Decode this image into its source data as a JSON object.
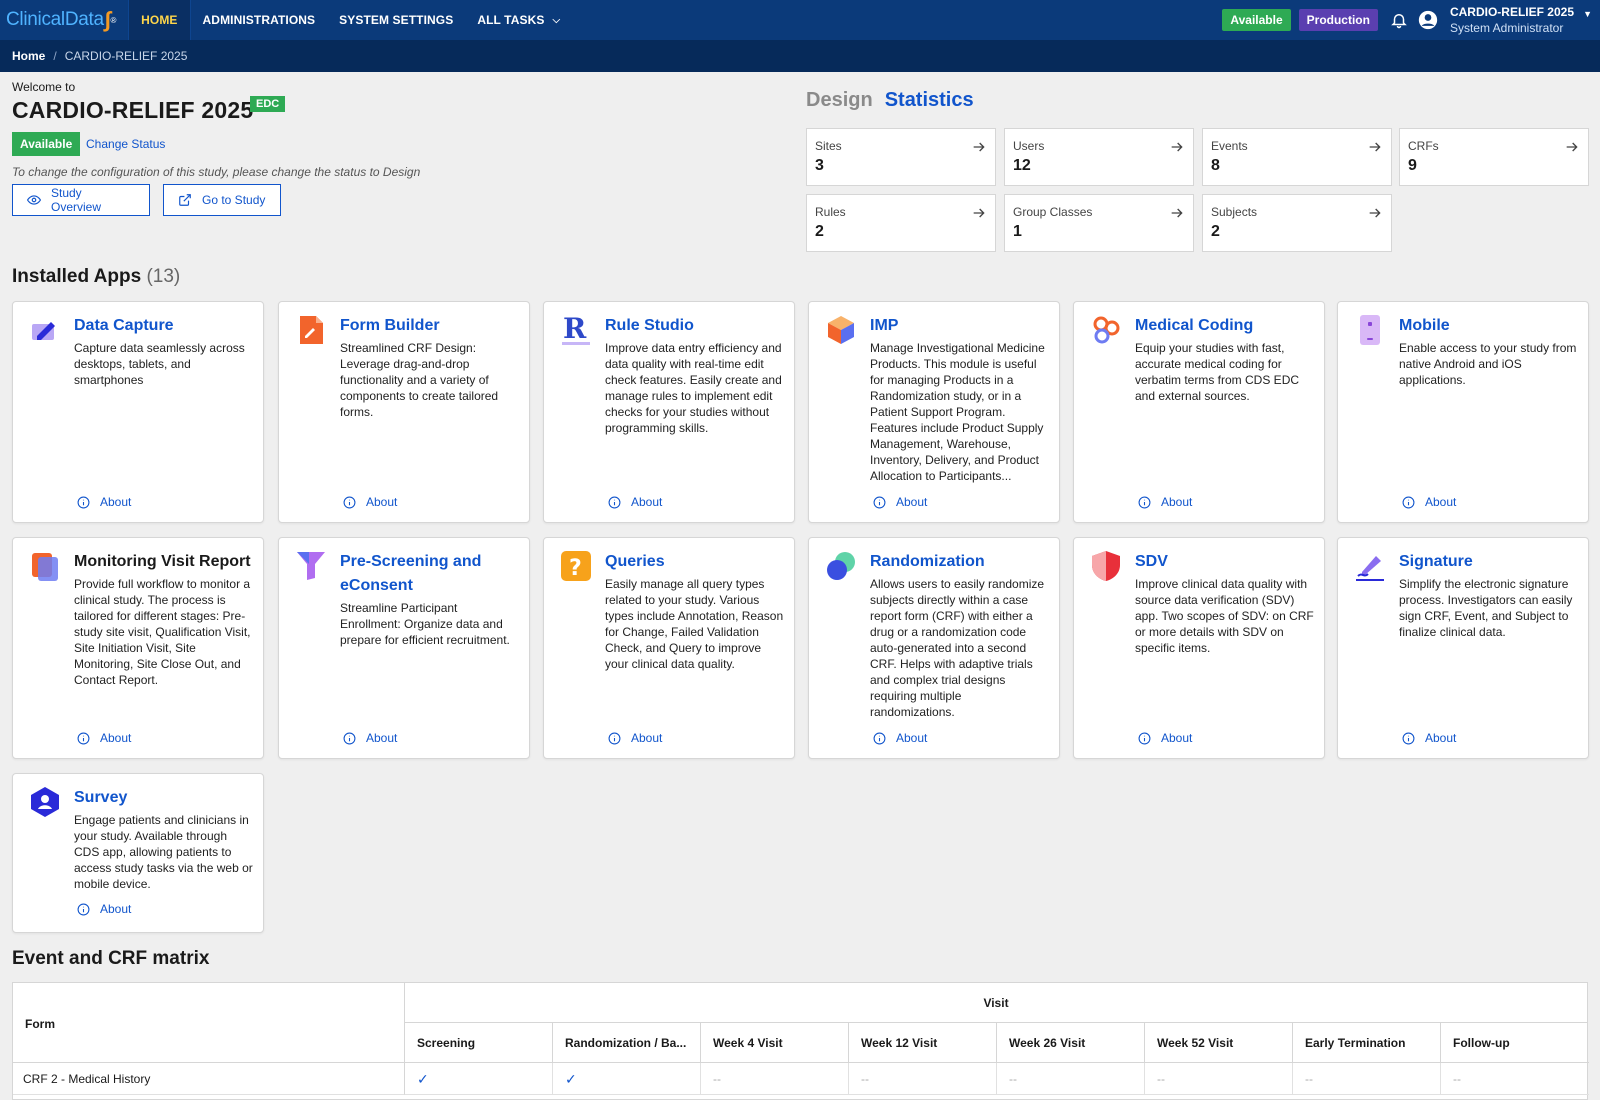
{
  "header": {
    "logo_text": "ClinicalData",
    "nav": [
      {
        "label": "HOME"
      },
      {
        "label": "ADMINISTRATIONS"
      },
      {
        "label": "SYSTEM SETTINGS"
      },
      {
        "label": "ALL TASKS"
      }
    ],
    "status_available": "Available",
    "env_label": "Production",
    "user_study": "CARDIO-RELIEF 2025",
    "user_role": "System Administrator"
  },
  "breadcrumb": {
    "home": "Home",
    "current": "CARDIO-RELIEF 2025"
  },
  "study": {
    "welcome": "Welcome to",
    "title": "CARDIO-RELIEF 2025",
    "badge": "EDC",
    "status": "Available",
    "change_status": "Change Status",
    "note": "To change the configuration of this study, please change the status to Design",
    "btn_overview": "Study Overview",
    "btn_go": "Go to Study"
  },
  "tabs": {
    "design": "Design",
    "statistics": "Statistics"
  },
  "stats": [
    {
      "label": "Sites",
      "value": "3"
    },
    {
      "label": "Users",
      "value": "12"
    },
    {
      "label": "Events",
      "value": "8"
    },
    {
      "label": "CRFs",
      "value": "9"
    },
    {
      "label": "Rules",
      "value": "2"
    },
    {
      "label": "Group Classes",
      "value": "1"
    },
    {
      "label": "Subjects",
      "value": "2"
    }
  ],
  "apps_section": {
    "title": "Installed Apps",
    "count": "(13)"
  },
  "apps": [
    {
      "title": "Data Capture",
      "desc": "Capture data seamlessly across desktops, tablets, and smartphones",
      "about": "About"
    },
    {
      "title": "Form Builder",
      "desc": "Streamlined CRF Design: Leverage drag-and-drop functionality and a variety of components to create tailored forms.",
      "about": "About"
    },
    {
      "title": "Rule Studio",
      "desc": "Improve data entry efficiency and data quality with real-time edit check features. Easily create and manage rules to implement edit checks for your studies without programming skills.",
      "about": "About"
    },
    {
      "title": "IMP",
      "desc": "Manage Investigational Medicine Products. This module is useful for managing Products in a Randomization study, or in a Patient Support Program. Features include Product Supply Management, Warehouse, Inventory, Delivery, and Product Allocation to Participants...",
      "about": "About"
    },
    {
      "title": "Medical Coding",
      "desc": "Equip your studies with fast, accurate medical coding for verbatim terms from CDS EDC and external sources.",
      "about": "About"
    },
    {
      "title": "Mobile",
      "desc": "Enable access to your study from native Android and iOS applications.",
      "about": "About"
    },
    {
      "title": "Monitoring Visit Report",
      "desc": "Provide full workflow to monitor a clinical study. The process is tailored for different stages: Pre-study site visit, Qualification Visit, Site Initiation Visit, Site Monitoring, Site Close Out, and Contact Report.",
      "about": "About"
    },
    {
      "title": "Pre-Screening and eConsent",
      "desc": "Streamline Participant Enrollment: Organize data and prepare for efficient recruitment.",
      "about": "About"
    },
    {
      "title": "Queries",
      "desc": "Easily manage all query types related to your study. Various types include Annotation, Reason for Change, Failed Validation Check, and Query to improve your clinical data quality.",
      "about": "About"
    },
    {
      "title": "Randomization",
      "desc": "Allows users to easily randomize subjects directly within a case report form (CRF) with either a drug or a randomization code auto-generated into a second CRF. Helps with adaptive trials and complex trial designs requiring multiple randomizations.",
      "about": "About"
    },
    {
      "title": "SDV",
      "desc": "Improve clinical data quality with source data verification (SDV) app. Two scopes of SDV: on CRF or more details with SDV on specific items.",
      "about": "About"
    },
    {
      "title": "Signature",
      "desc": "Simplify the electronic signature process. Investigators can easily sign CRF, Event, and Subject to finalize clinical data.",
      "about": "About"
    },
    {
      "title": "Survey",
      "desc": "Engage patients and clinicians in your study. Available through CDS app, allowing patients to access study tasks via the web or mobile device.",
      "about": "About"
    }
  ],
  "matrix": {
    "title": "Event and CRF matrix",
    "form_header": "Form",
    "visit_header": "Visit",
    "columns": [
      "Screening",
      "Randomization / Ba...",
      "Week 4 Visit",
      "Week 12 Visit",
      "Week 26 Visit",
      "Week 52 Visit",
      "Early Termination",
      "Follow-up"
    ],
    "rows": [
      {
        "label": "CRF 2 - Medical History",
        "cells": [
          "✓",
          "✓",
          "--",
          "--",
          "--",
          "--",
          "--",
          "--"
        ]
      }
    ]
  },
  "colors": {
    "primary": "#1155cc",
    "nav_bg": "#0b3a7a",
    "green": "#2eaa54",
    "purple": "#5a3fb0"
  }
}
